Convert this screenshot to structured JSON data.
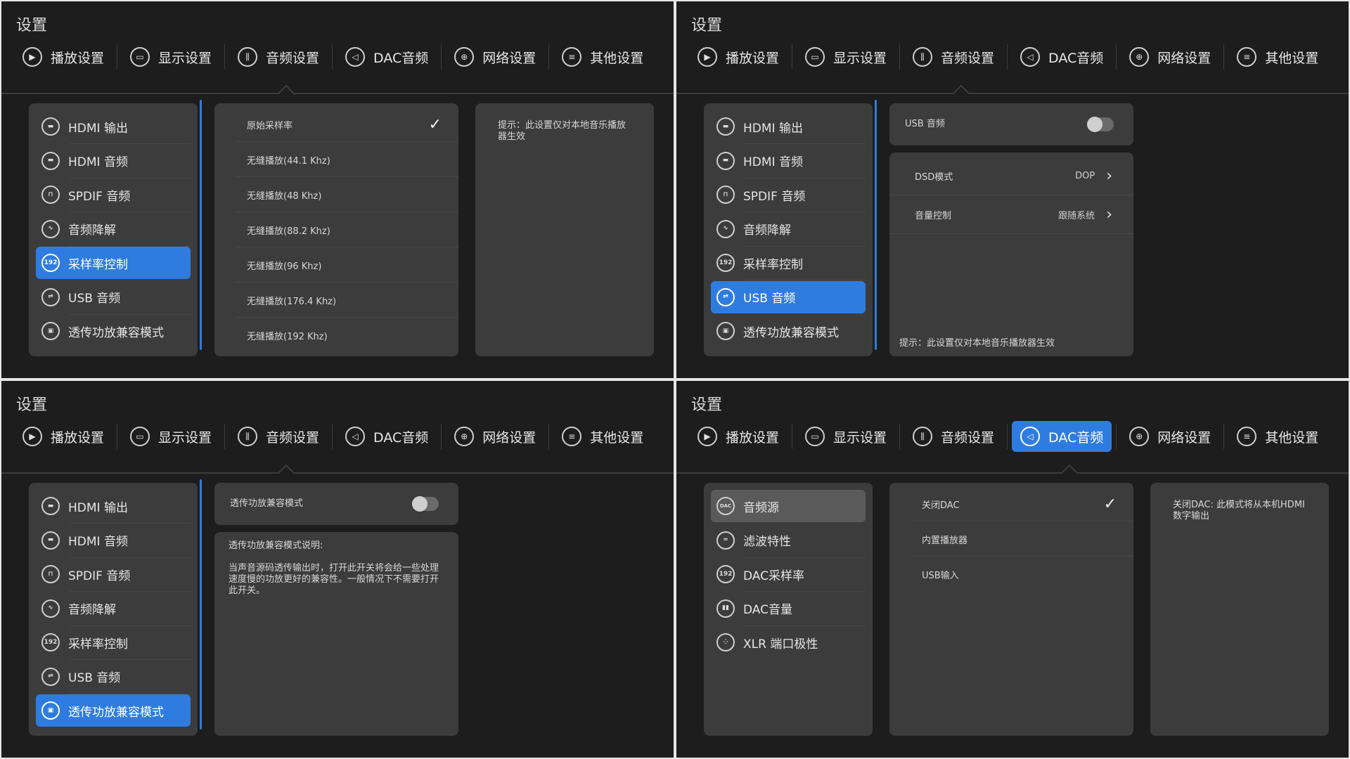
{
  "settings_title": "设置",
  "tabs": [
    {
      "label": "播放设置",
      "icon": "play-icon"
    },
    {
      "label": "显示设置",
      "icon": "monitor-icon"
    },
    {
      "label": "音频设置",
      "icon": "equalizer-icon"
    },
    {
      "label": "DAC音频",
      "icon": "speaker-icon"
    },
    {
      "label": "网络设置",
      "icon": "globe-icon"
    },
    {
      "label": "其他设置",
      "icon": "menu-icon"
    }
  ],
  "audio_menu": [
    {
      "label": "HDMI 输出",
      "icon": "hdmi-out-icon"
    },
    {
      "label": "HDMI 音频",
      "icon": "hdmi-icon"
    },
    {
      "label": "SPDIF 音频",
      "icon": "spdif-icon"
    },
    {
      "label": "音频降解",
      "icon": "waveform-icon"
    },
    {
      "label": "采样率控制",
      "icon": "sample-rate-icon"
    },
    {
      "label": "USB 音频",
      "icon": "usb-icon"
    },
    {
      "label": "透传功放兼容模式",
      "icon": "passthrough-icon"
    }
  ],
  "q1": {
    "options": [
      "原始采样率",
      "无缝播放(44.1 Khz)",
      "无缝播放(48 Khz)",
      "无缝播放(88.2 Khz)",
      "无缝播放(96 Khz)",
      "无缝播放(176.4 Khz)",
      "无缝播放(192 Khz)"
    ],
    "selected_index": 0,
    "hint": "提示：此设置仅对本地音乐播放器生效"
  },
  "q2": {
    "usb_audio_label": "USB 音频",
    "dsd_label": "DSD模式",
    "dsd_value": "DOP",
    "volume_label": "音量控制",
    "volume_value": "跟随系统",
    "hint": "提示：此设置仅对本地音乐播放器生效"
  },
  "q3": {
    "toggle_label": "透传功放兼容模式",
    "desc_title": "透传功放兼容模式说明:",
    "desc_body": "当声音源码透传输出时，打开此开关将会给一些处理速度慢的功放更好的兼容性。一般情况下不需要打开此开关。"
  },
  "q4": {
    "menu": [
      {
        "label": "音频源",
        "icon": "dac-icon"
      },
      {
        "label": "滤波特性",
        "icon": "filter-icon"
      },
      {
        "label": "DAC采样率",
        "icon": "sample-rate-icon"
      },
      {
        "label": "DAC音量",
        "icon": "volume-icon"
      },
      {
        "label": "XLR 端口极性",
        "icon": "xlr-icon"
      }
    ],
    "options": [
      "关闭DAC",
      "内置播放器",
      "USB输入"
    ],
    "selected_index": 0,
    "hint": "关闭DAC: 此模式将从本机HDMI数字输出"
  }
}
